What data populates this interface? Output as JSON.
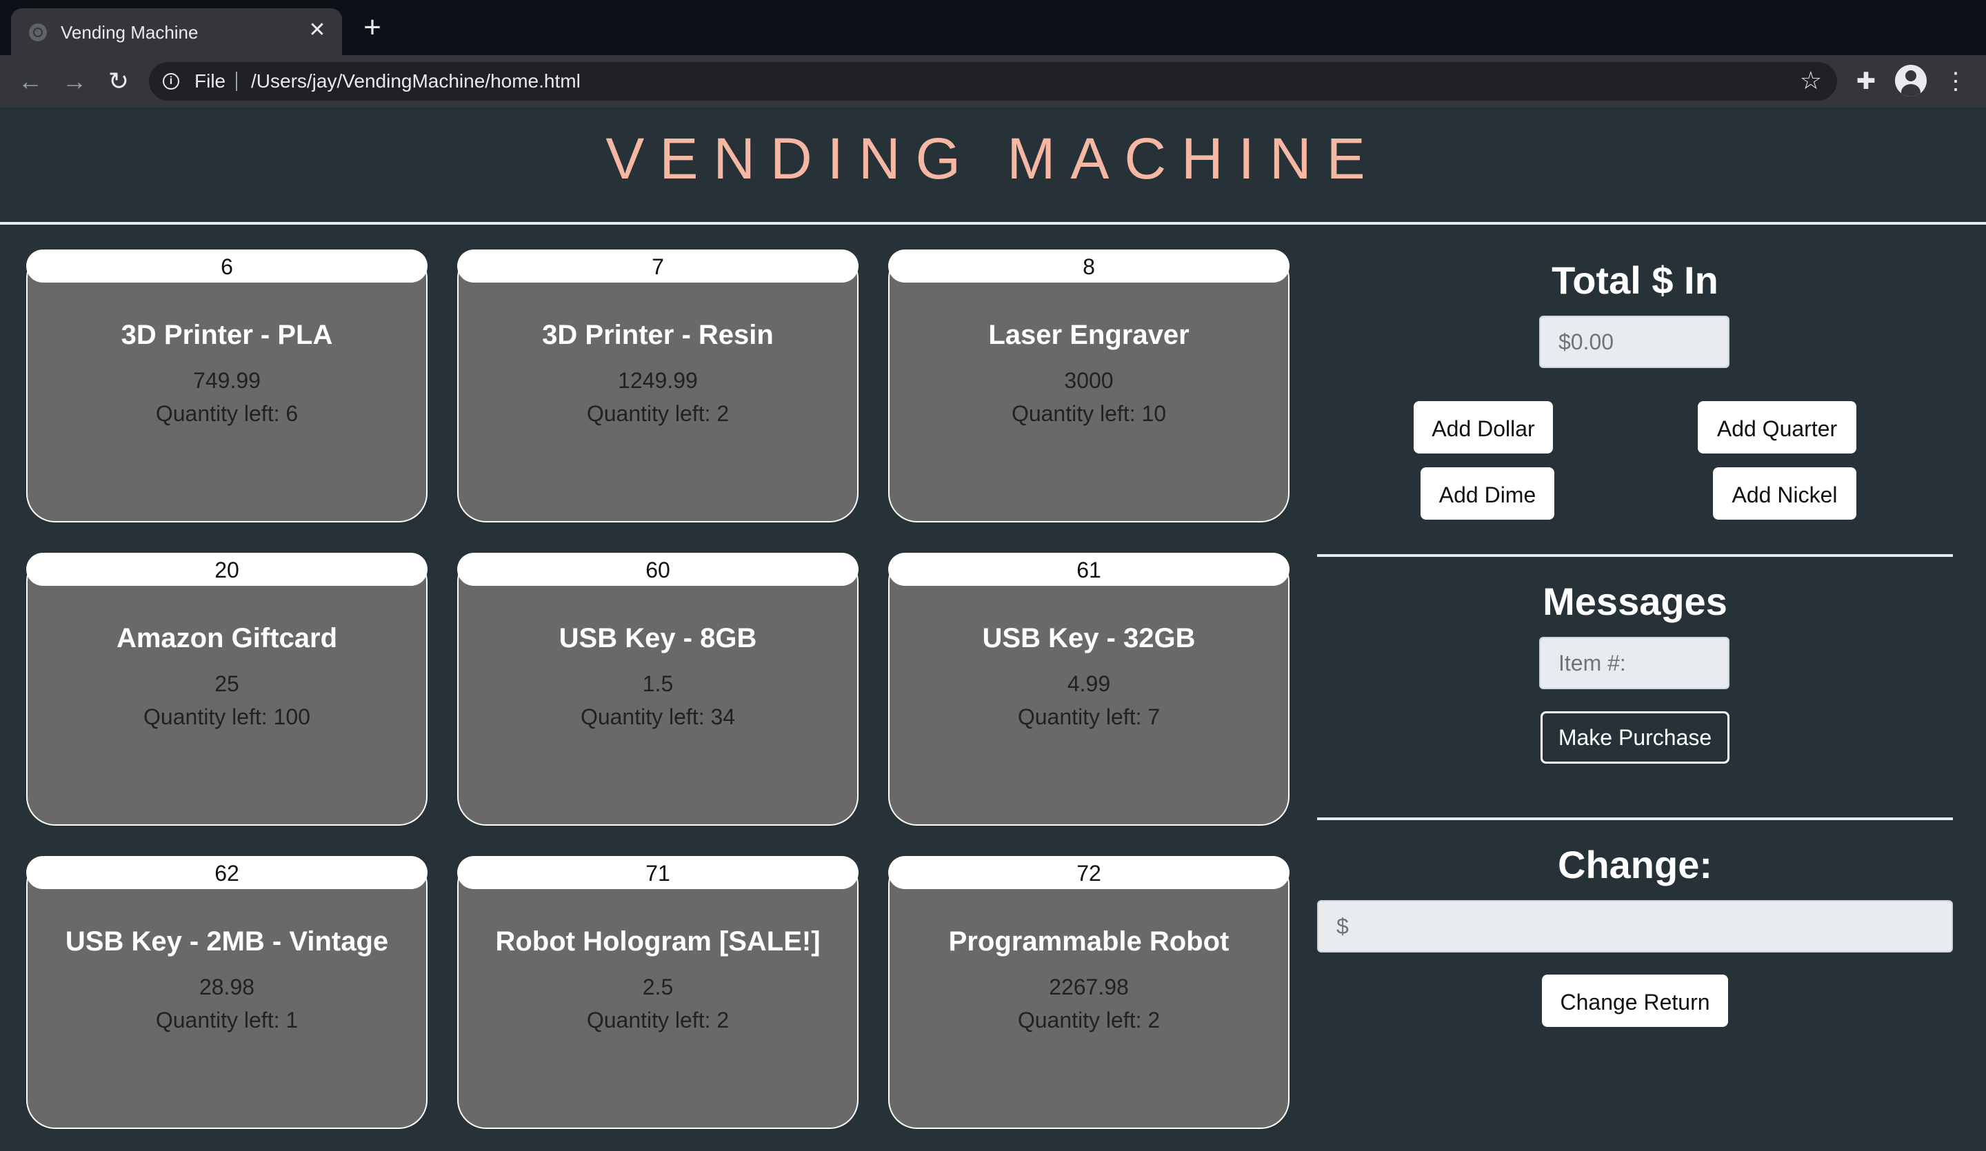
{
  "browser": {
    "tab_title": "Vending Machine",
    "tab_close": "✕",
    "new_tab": "+",
    "scheme": "File",
    "url": "/Users/jay/VendingMachine/home.html"
  },
  "page": {
    "title": "VENDING MACHINE"
  },
  "items": [
    {
      "id": "6",
      "name": "3D Printer - PLA",
      "price": "749.99",
      "qty": "Quantity left: 6"
    },
    {
      "id": "7",
      "name": "3D Printer - Resin",
      "price": "1249.99",
      "qty": "Quantity left: 2"
    },
    {
      "id": "8",
      "name": "Laser Engraver",
      "price": "3000",
      "qty": "Quantity left: 10"
    },
    {
      "id": "20",
      "name": "Amazon Giftcard",
      "price": "25",
      "qty": "Quantity left: 100"
    },
    {
      "id": "60",
      "name": "USB Key - 8GB",
      "price": "1.5",
      "qty": "Quantity left: 34"
    },
    {
      "id": "61",
      "name": "USB Key - 32GB",
      "price": "4.99",
      "qty": "Quantity left: 7"
    },
    {
      "id": "62",
      "name": "USB Key - 2MB - Vintage",
      "price": "28.98",
      "qty": "Quantity left: 1"
    },
    {
      "id": "71",
      "name": "Robot Hologram [SALE!]",
      "price": "2.5",
      "qty": "Quantity left: 2"
    },
    {
      "id": "72",
      "name": "Programmable Robot",
      "price": "2267.98",
      "qty": "Quantity left: 2"
    }
  ],
  "money": {
    "title": "Total $ In",
    "placeholder": "$0.00",
    "add_dollar": "Add Dollar",
    "add_quarter": "Add Quarter",
    "add_dime": "Add Dime",
    "add_nickel": "Add Nickel"
  },
  "messages": {
    "title": "Messages",
    "item_placeholder": "Item #:",
    "purchase_label": "Make Purchase"
  },
  "change": {
    "title": "Change:",
    "placeholder": "$",
    "return_label": "Change Return"
  }
}
